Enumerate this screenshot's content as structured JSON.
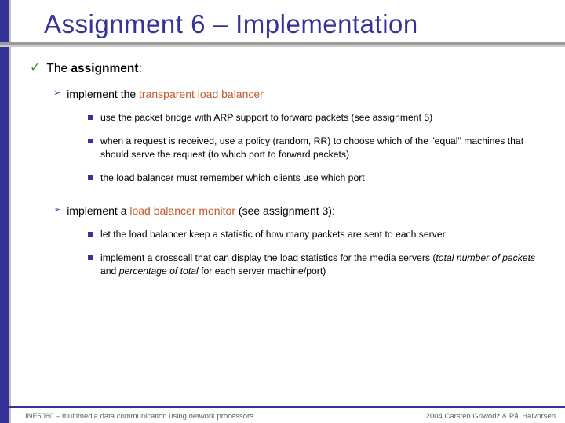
{
  "title": "Assignment 6 – Implementation",
  "sectionLabel": "The ",
  "sectionBold": "assignment",
  "sectionAfter": ":",
  "sub1_pre": "implement the ",
  "sub1_kw": "transparent load balancer",
  "b1": "use the packet bridge with ARP support to forward packets (see assignment 5)",
  "b2": "when a request is received, use a policy (random, RR) to choose which of the \"equal\" machines that should serve the request (to which port to forward packets)",
  "b3": "the load balancer must remember which clients use which port",
  "sub2_pre": "implement a ",
  "sub2_kw": "load balancer monitor",
  "sub2_post": " (see assignment 3):",
  "b4": "let the load balancer keep a statistic of how many packets are sent to each server",
  "b5_pre": "implement a crosscall that can display the load statistics for the media servers (",
  "b5_i1": "total number of packets",
  "b5_mid": " and ",
  "b5_i2": "percentage of total",
  "b5_post": " for each server machine/port)",
  "footerLeft": "INF5060 – multimedia data communication using network processors",
  "footerRight": "2004 Carsten Griwodz & Pål Halvorsen"
}
